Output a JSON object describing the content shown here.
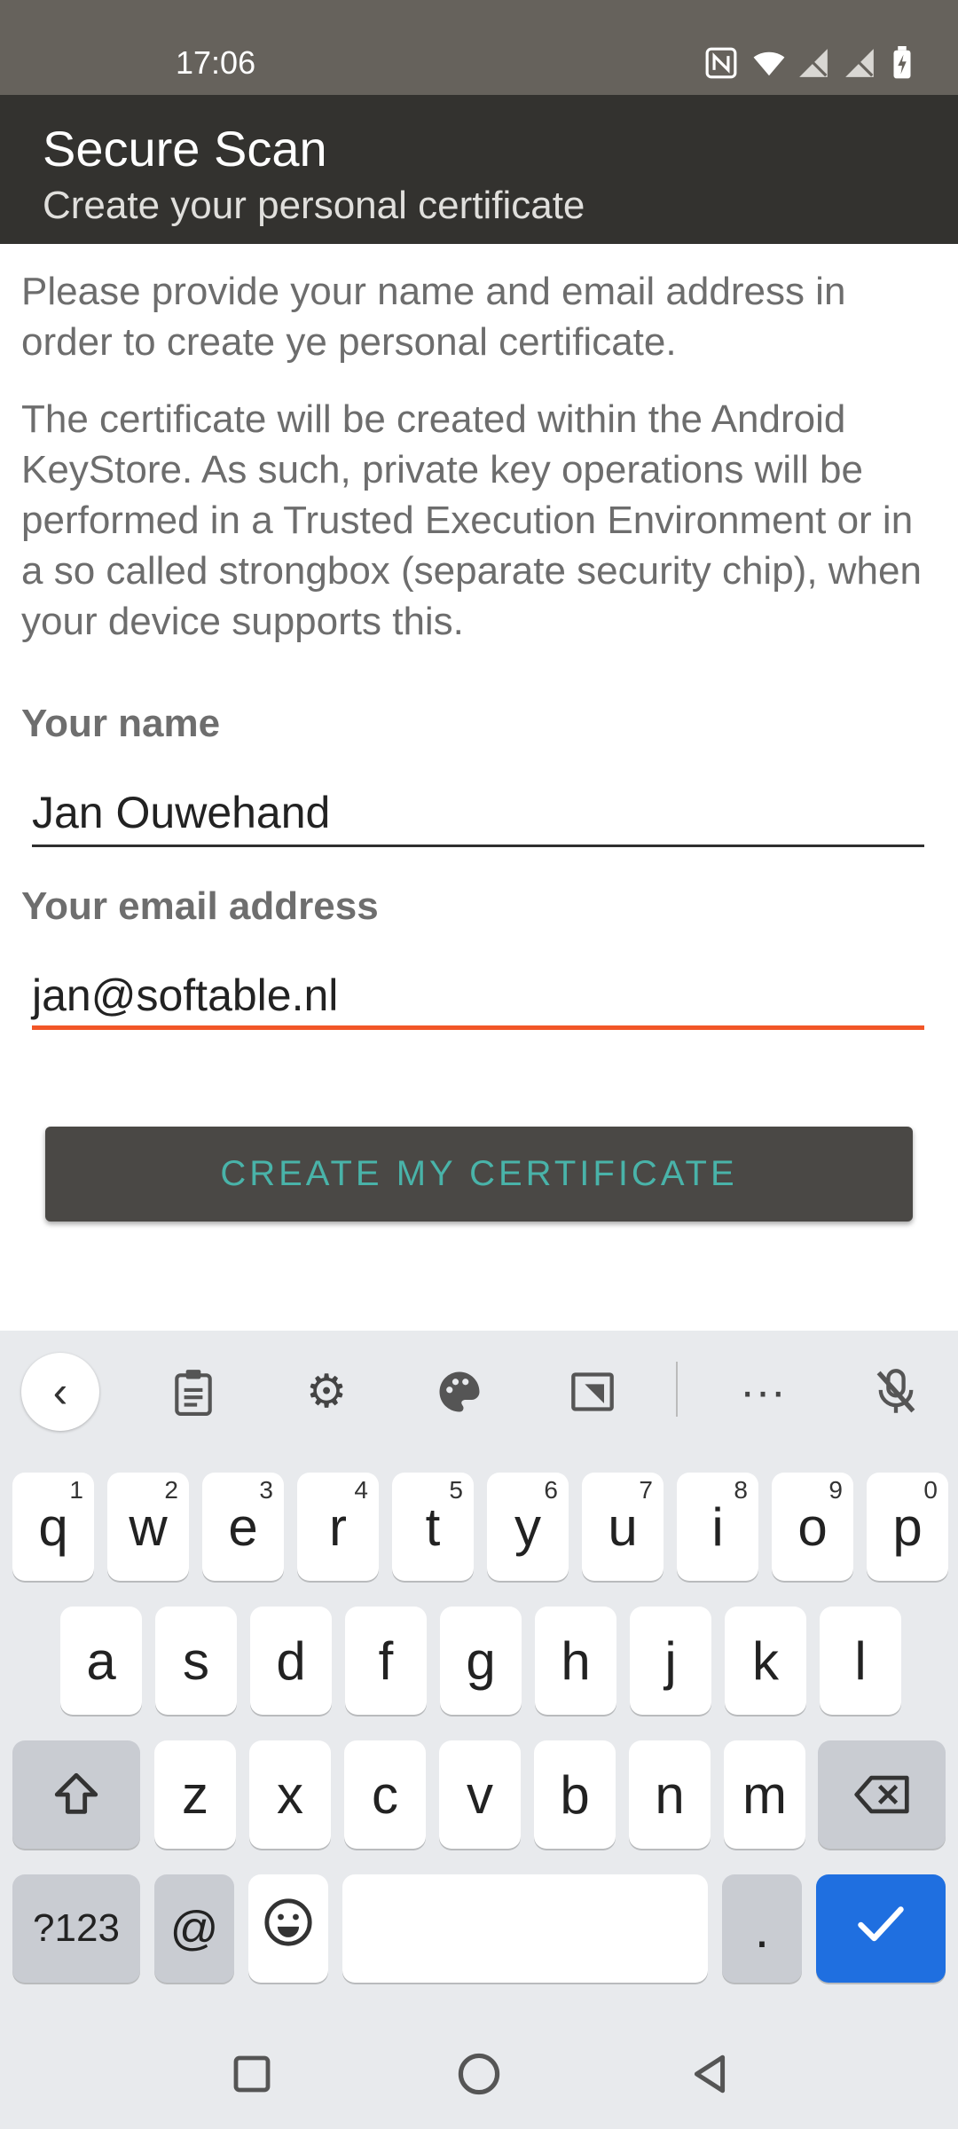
{
  "status_bar": {
    "time": "17:06"
  },
  "app_bar": {
    "title": "Secure Scan",
    "subtitle": "Create your personal certificate"
  },
  "content": {
    "intro": "Please provide your name and email address in order to create ye personal certificate.",
    "details": "The certificate will be created within the Android KeyStore. As such, private key operations will be performed in a Trusted Execution Environment or in a so called strongbox (separate security chip), when your device supports this.",
    "name_label": "Your name",
    "name_value": "Jan Ouwehand",
    "email_label": "Your email address",
    "email_value": "jan@softable.nl",
    "button_label": "CREATE MY CERTIFICATE"
  },
  "keyboard": {
    "row1": [
      {
        "key": "q",
        "hint": "1"
      },
      {
        "key": "w",
        "hint": "2"
      },
      {
        "key": "e",
        "hint": "3"
      },
      {
        "key": "r",
        "hint": "4"
      },
      {
        "key": "t",
        "hint": "5"
      },
      {
        "key": "y",
        "hint": "6"
      },
      {
        "key": "u",
        "hint": "7"
      },
      {
        "key": "i",
        "hint": "8"
      },
      {
        "key": "o",
        "hint": "9"
      },
      {
        "key": "p",
        "hint": "0"
      }
    ],
    "row2": [
      "a",
      "s",
      "d",
      "f",
      "g",
      "h",
      "j",
      "k",
      "l"
    ],
    "row3": [
      "z",
      "x",
      "c",
      "v",
      "b",
      "n",
      "m"
    ],
    "symbols_key": "?123",
    "at_key": "@",
    "period_key": ".",
    "icons": {
      "shift": "shift-icon",
      "backspace": "backspace-icon",
      "emoji": "emoji-icon",
      "enter": "checkmark-icon",
      "back": "chevron-left-icon",
      "clipboard": "clipboard-icon",
      "settings": "gear-icon",
      "theme": "palette-icon",
      "resize": "resize-icon",
      "more": "more-icon",
      "mic": "mic-off-icon"
    }
  },
  "colors": {
    "accent": "#f25627",
    "button_text": "#49b3a9",
    "app_bar": "#33322f",
    "enter_key": "#1f6fe0"
  }
}
